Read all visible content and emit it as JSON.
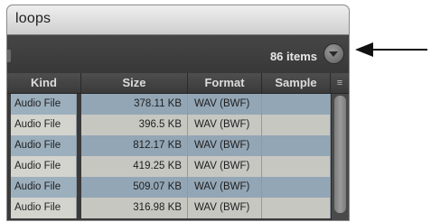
{
  "window": {
    "title": "loops"
  },
  "toolbar": {
    "item_count": "86 items",
    "menu_icon": "chevron-down-circle-icon"
  },
  "table": {
    "columns": [
      "Kind",
      "Size",
      "Format",
      "Sample"
    ],
    "sort_icon": "≡",
    "rows": [
      {
        "kind": "Audio File",
        "size": "378.11 KB",
        "format": "WAV (BWF)",
        "sample": ""
      },
      {
        "kind": "Audio File",
        "size": "396.5 KB",
        "format": "WAV (BWF)",
        "sample": ""
      },
      {
        "kind": "Audio File",
        "size": "812.17 KB",
        "format": "WAV (BWF)",
        "sample": ""
      },
      {
        "kind": "Audio File",
        "size": "419.25 KB",
        "format": "WAV (BWF)",
        "sample": ""
      },
      {
        "kind": "Audio File",
        "size": "509.07 KB",
        "format": "WAV (BWF)",
        "sample": ""
      },
      {
        "kind": "Audio File",
        "size": "316.98 KB",
        "format": "WAV (BWF)",
        "sample": ""
      }
    ]
  }
}
